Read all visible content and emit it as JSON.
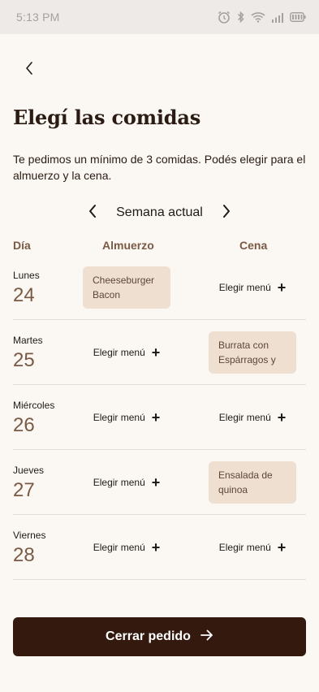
{
  "status_bar": {
    "time": "5:13 PM",
    "icons": [
      "alarm-icon",
      "bluetooth-icon",
      "wifi-icon",
      "signal-icon",
      "battery-icon"
    ]
  },
  "header": {
    "back_icon": "chevron-left-icon",
    "title": "Elegí las comidas"
  },
  "subtitle": "Te pedimos un mínimo de 3 comidas. Podés elegir para el almuerzo y la cena.",
  "week_nav": {
    "label": "Semana actual",
    "prev_icon": "chevron-left-icon",
    "next_icon": "chevron-right-icon"
  },
  "columns": {
    "day": "Día",
    "lunch": "Almuerzo",
    "dinner": "Cena"
  },
  "days": [
    {
      "name": "Lunes",
      "num": "24",
      "lunch": {
        "selected": true,
        "text": "Cheeseburger Bacon"
      },
      "dinner": {
        "selected": false,
        "text": "Elegir menú"
      }
    },
    {
      "name": "Martes",
      "num": "25",
      "lunch": {
        "selected": false,
        "text": "Elegir menú"
      },
      "dinner": {
        "selected": true,
        "text": "Burrata con Espárragos y ..."
      }
    },
    {
      "name": "Miércoles",
      "num": "26",
      "lunch": {
        "selected": false,
        "text": "Elegir menú"
      },
      "dinner": {
        "selected": false,
        "text": "Elegir menú"
      }
    },
    {
      "name": "Jueves",
      "num": "27",
      "lunch": {
        "selected": false,
        "text": "Elegir menú"
      },
      "dinner": {
        "selected": true,
        "text": "Ensalada de quinoa"
      }
    },
    {
      "name": "Viernes",
      "num": "28",
      "lunch": {
        "selected": false,
        "text": "Elegir menú"
      },
      "dinner": {
        "selected": false,
        "text": "Elegir menú"
      }
    }
  ],
  "cta": {
    "label": "Cerrar pedido",
    "icon": "arrow-right-icon"
  },
  "colors": {
    "background": "#FBF7F3",
    "accent": "#7A5A45",
    "chip": "#EEDFD1",
    "button": "#33190E"
  }
}
